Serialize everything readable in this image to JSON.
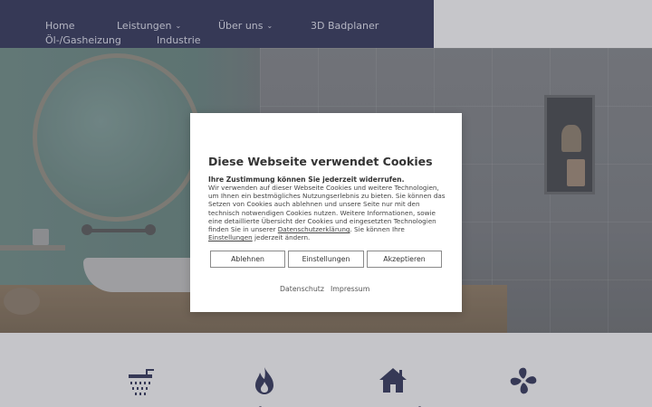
{
  "nav": {
    "items": [
      {
        "label": "Home",
        "dropdown": false
      },
      {
        "label": "Leistungen",
        "dropdown": true
      },
      {
        "label": "Über uns",
        "dropdown": true
      },
      {
        "label": "3D Badplaner",
        "dropdown": false
      },
      {
        "label": "Öl-/Gasheizung",
        "dropdown": false
      },
      {
        "label": "Industrie",
        "dropdown": false
      }
    ],
    "chevron": "⌄"
  },
  "cookie": {
    "title": "Diese Webseite verwendet Cookies",
    "subtitle": "Ihre Zustimmung können Sie jederzeit widerrufen.",
    "body_part1": "Wir verwenden auf dieser Webseite Cookies und weitere Technologien, um Ihnen ein bestmögliches Nutzungserlebnis zu bieten. Sie können das Setzen von Cookies auch ablehnen und unsere Seite nur mit den technisch notwendigen Cookies nutzen. Weitere Informationen, sowie eine detaillierte Übersicht der Cookies und eingesetzten Technologien finden Sie in unserer ",
    "link_privacy": "Datenschutzerklärung",
    "body_part2": ". Sie können Ihre ",
    "link_settings": "Einstellungen",
    "body_part3": " jederzeit ändern.",
    "buttons": {
      "reject": "Ablehnen",
      "settings": "Einstellungen",
      "accept": "Akzeptieren"
    },
    "footer_links": {
      "privacy": "Datenschutz",
      "imprint": "Impressum"
    }
  },
  "features": [
    {
      "icon": "shower-icon"
    },
    {
      "icon": "flame-icon"
    },
    {
      "icon": "house-icon"
    },
    {
      "icon": "fan-icon"
    }
  ],
  "colors": {
    "nav_bg": "#3a3d5e",
    "icon": "#3a3d5e"
  }
}
